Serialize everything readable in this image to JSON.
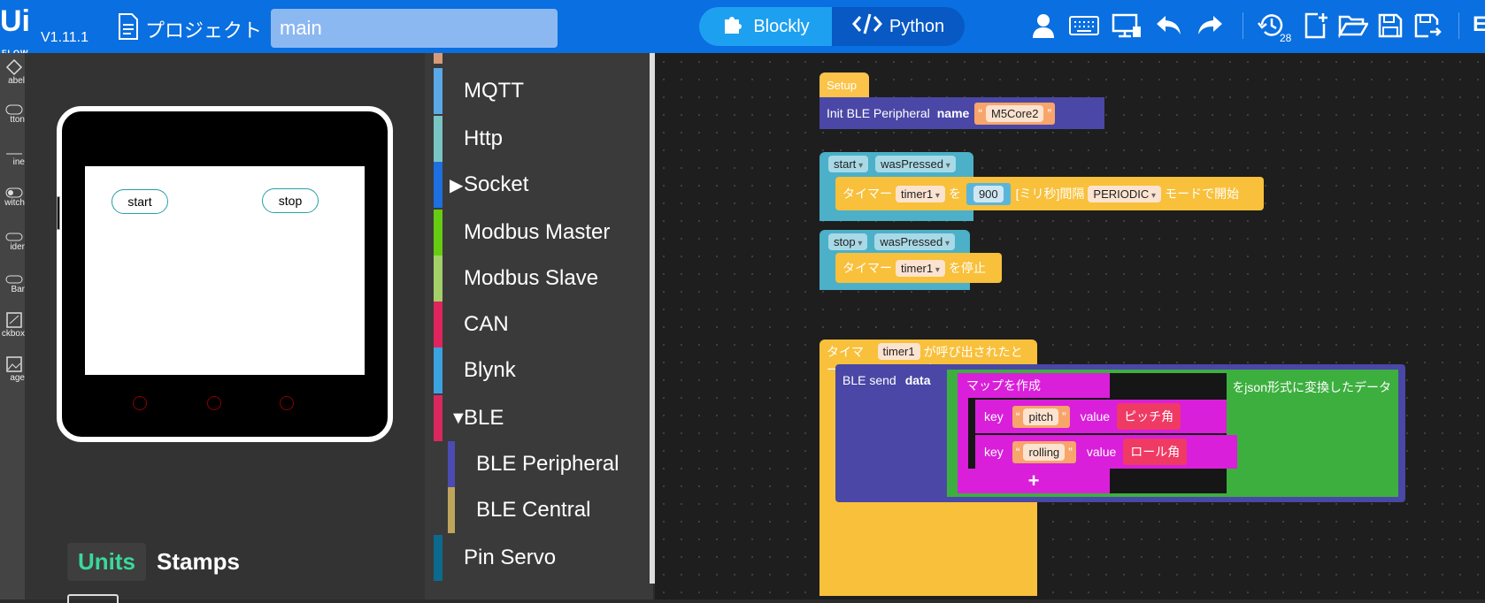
{
  "app": {
    "logo": "Ui",
    "logo_sub": "FLOW",
    "version": "V1.11.1"
  },
  "header": {
    "project_label": "プロジェクト",
    "project_name": "main",
    "mode_blockly": "Blockly",
    "mode_python": "Python",
    "history_count": "28",
    "cut_label": "E"
  },
  "left_strip": {
    "items": [
      "abel",
      "tton",
      "ine",
      "witch",
      "ider",
      "Bar",
      "ckbox",
      "age"
    ]
  },
  "preview": {
    "buttons": [
      {
        "label": "start"
      },
      {
        "label": "stop"
      }
    ],
    "tabs": [
      {
        "label": "Units"
      },
      {
        "label": "Stamps"
      }
    ]
  },
  "categories": [
    {
      "label": "MQTT",
      "color": "#5aa9e6"
    },
    {
      "label": "Http",
      "color": "#7ac4c4"
    },
    {
      "label": "Socket",
      "color": "#1e6fe0",
      "expand": "▶"
    },
    {
      "label": "Modbus Master",
      "color": "#66cc11"
    },
    {
      "label": "Modbus Slave",
      "color": "#a3d069"
    },
    {
      "label": "CAN",
      "color": "#e0245e"
    },
    {
      "label": "Blynk",
      "color": "#3aa3e0"
    },
    {
      "label": "BLE",
      "color": "#d9285f",
      "expand": "▼"
    },
    {
      "label": "BLE Peripheral",
      "color": "#4b4bb3"
    },
    {
      "label": "BLE Central",
      "color": "#bfa55c"
    },
    {
      "label": "Pin Servo",
      "color": "#0b6a8e"
    }
  ],
  "blocks": {
    "setup": "Setup",
    "init_ble": "Init BLE Peripheral",
    "name_kw": "name",
    "name_val": "M5Core2",
    "start": "start",
    "was_pressed": "wasPressed",
    "timer_kw": "タイマー",
    "timer1": "timer1",
    "wo": "を",
    "interval": "900",
    "ms_label": "[ミリ秒]間隔",
    "periodic": "PERIODIC",
    "mode_start": "モードで開始",
    "stop": "stop",
    "wo_stop": "を停止",
    "called_when": "が呼び出されたとき",
    "ble_send": "BLE send",
    "data_kw": "data",
    "make_map": "マップを作成",
    "to_json": "をjson形式に変換したデータ",
    "key_kw": "key",
    "value_kw": "value",
    "key1": "pitch",
    "val1": "ピッチ角",
    "key2": "rolling",
    "val2": "ロール角",
    "plus": "+",
    "quote_open": "“",
    "quote_close": "”"
  }
}
